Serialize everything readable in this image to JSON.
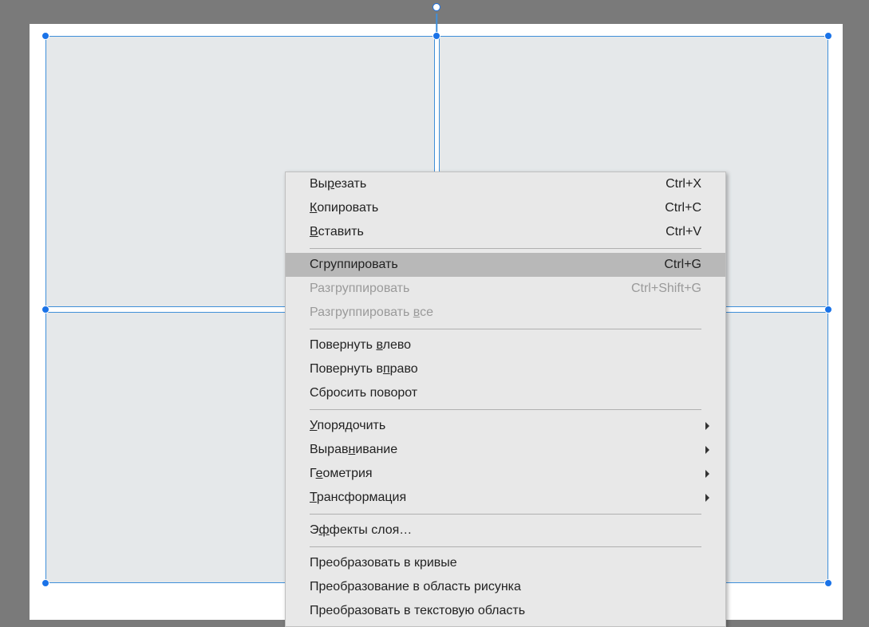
{
  "menu": {
    "items": [
      {
        "label_pre": "Вы",
        "mnemonic": "р",
        "label_post": "езать",
        "shortcut": "Ctrl+X",
        "type": "item"
      },
      {
        "label_pre": "",
        "mnemonic": "К",
        "label_post": "опировать",
        "shortcut": "Ctrl+C",
        "type": "item"
      },
      {
        "label_pre": "",
        "mnemonic": "В",
        "label_post": "ставить",
        "shortcut": "Ctrl+V",
        "type": "item"
      },
      {
        "type": "separator"
      },
      {
        "label_pre": "Сгруппировать",
        "mnemonic": "",
        "label_post": "",
        "shortcut": "Ctrl+G",
        "type": "item",
        "highlighted": true
      },
      {
        "label_pre": "Разгруппировать",
        "mnemonic": "",
        "label_post": "",
        "shortcut": "Ctrl+Shift+G",
        "type": "item",
        "disabled": true
      },
      {
        "label_pre": "Разгруппировать ",
        "mnemonic": "в",
        "label_post": "се",
        "shortcut": "",
        "type": "item",
        "disabled": true
      },
      {
        "type": "separator"
      },
      {
        "label_pre": "Повернуть ",
        "mnemonic": "в",
        "label_post": "лево",
        "shortcut": "",
        "type": "item"
      },
      {
        "label_pre": "Повернуть в",
        "mnemonic": "п",
        "label_post": "раво",
        "shortcut": "",
        "type": "item"
      },
      {
        "label_pre": "Сбросить поворот",
        "mnemonic": "",
        "label_post": "",
        "shortcut": "",
        "type": "item"
      },
      {
        "type": "separator"
      },
      {
        "label_pre": "",
        "mnemonic": "У",
        "label_post": "порядочить",
        "shortcut": "",
        "type": "submenu"
      },
      {
        "label_pre": "Вырав",
        "mnemonic": "н",
        "label_post": "ивание",
        "shortcut": "",
        "type": "submenu"
      },
      {
        "label_pre": "Г",
        "mnemonic": "е",
        "label_post": "ометрия",
        "shortcut": "",
        "type": "submenu"
      },
      {
        "label_pre": "",
        "mnemonic": "Т",
        "label_post": "рансформация",
        "shortcut": "",
        "type": "submenu"
      },
      {
        "type": "separator"
      },
      {
        "label_pre": "Э",
        "mnemonic": "ф",
        "label_post": "фекты слоя…",
        "shortcut": "",
        "type": "item"
      },
      {
        "type": "separator"
      },
      {
        "label_pre": "Преобразовать в кривые",
        "mnemonic": "",
        "label_post": "",
        "shortcut": "",
        "type": "item"
      },
      {
        "label_pre": "Преобразование в область рисунка",
        "mnemonic": "",
        "label_post": "",
        "shortcut": "",
        "type": "item"
      },
      {
        "label_pre": "Преобразовать в текстовую область",
        "mnemonic": "",
        "label_post": "",
        "shortcut": "",
        "type": "item"
      }
    ]
  }
}
